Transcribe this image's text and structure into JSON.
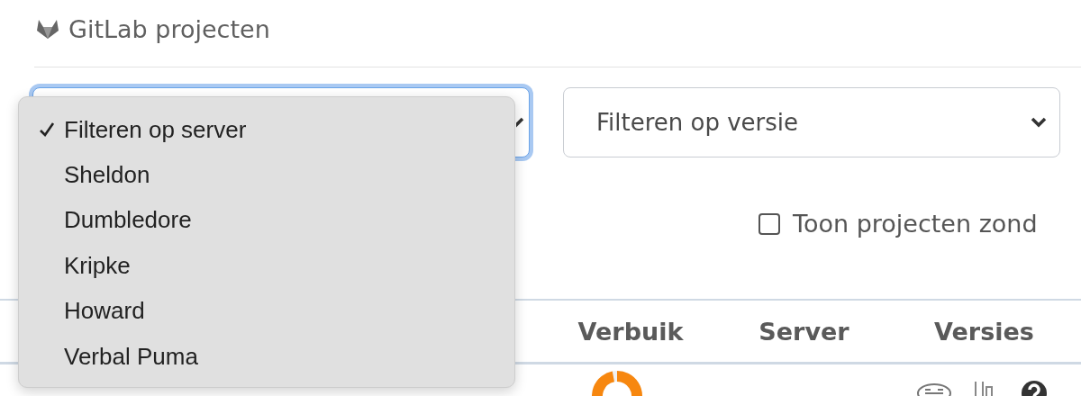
{
  "header": {
    "title": "GitLab projecten"
  },
  "filters": {
    "server_select": {
      "open": true
    },
    "version_select": {
      "value": "Filteren op versie"
    }
  },
  "server_menu": [
    {
      "label": "Filteren op server",
      "selected": true
    },
    {
      "label": "Sheldon",
      "selected": false
    },
    {
      "label": "Dumbledore",
      "selected": false
    },
    {
      "label": "Kripke",
      "selected": false
    },
    {
      "label": "Howard",
      "selected": false
    },
    {
      "label": "Verbal Puma",
      "selected": false
    }
  ],
  "option": {
    "label": "Toon projecten zond",
    "checked": false
  },
  "table": {
    "columns": [
      "Verbuik",
      "Server",
      "Versies"
    ]
  }
}
